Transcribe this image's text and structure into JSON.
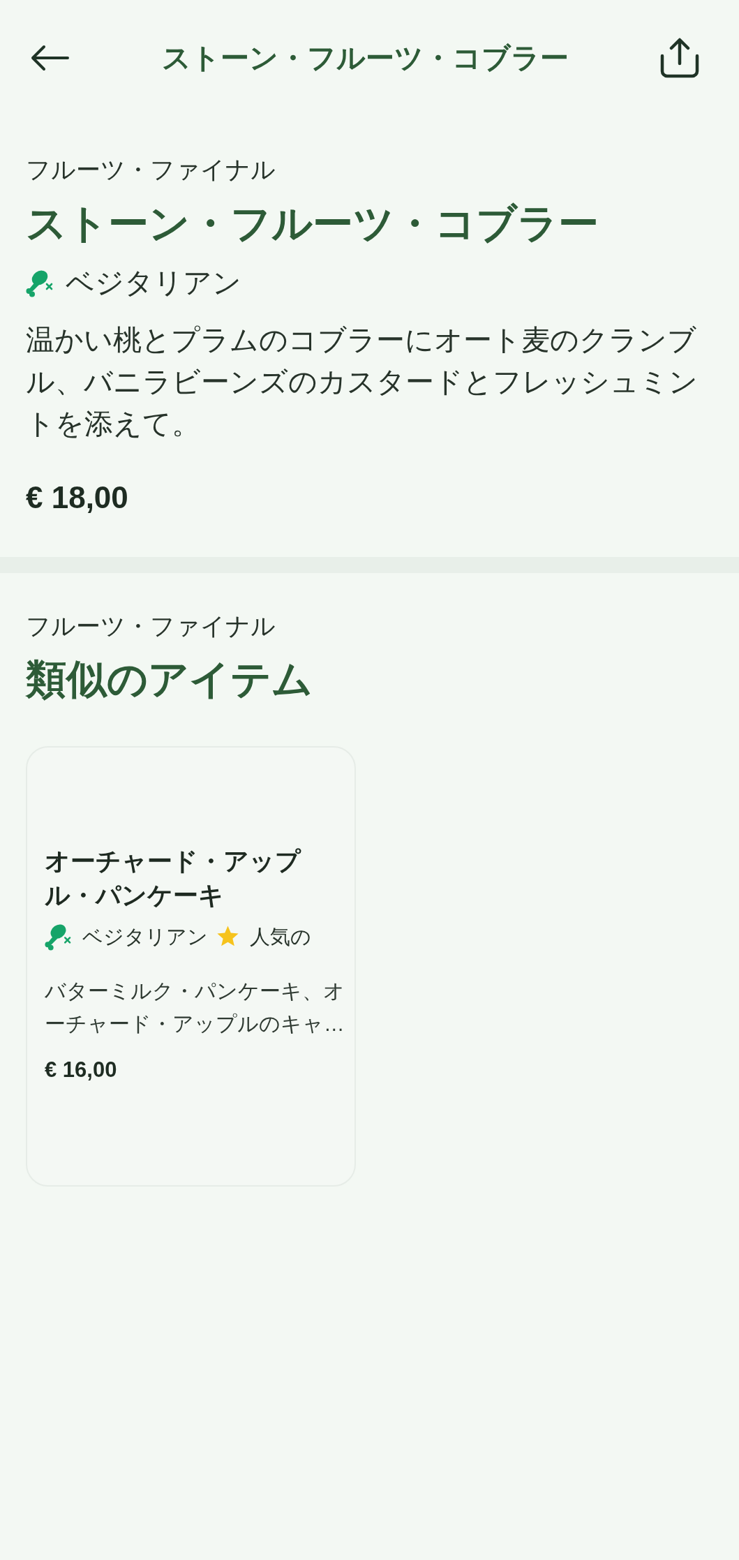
{
  "header": {
    "title": "ストーン・フルーツ・コブラー"
  },
  "item": {
    "category": "フルーツ・ファイナル",
    "title": "ストーン・フルーツ・コブラー",
    "tags": [
      {
        "kind": "vegetarian",
        "label": "ベジタリアン"
      }
    ],
    "description": "温かい桃とプラムのコブラーにオート麦のクランブル、バニラビーンズのカスタードとフレッシュミントを添えて。",
    "price": "€ 18,00"
  },
  "similar": {
    "category": "フルーツ・ファイナル",
    "heading": "類似のアイテム",
    "cards": [
      {
        "title": "オーチャード・アップル・パンケーキ",
        "tags": [
          {
            "kind": "vegetarian",
            "label": "ベジタリアン"
          },
          {
            "kind": "popular",
            "label": "人気の"
          }
        ],
        "description": "バターミルク・パンケーキ、オーチャード・アップルのキャ…",
        "price": "€ 16,00"
      }
    ]
  }
}
